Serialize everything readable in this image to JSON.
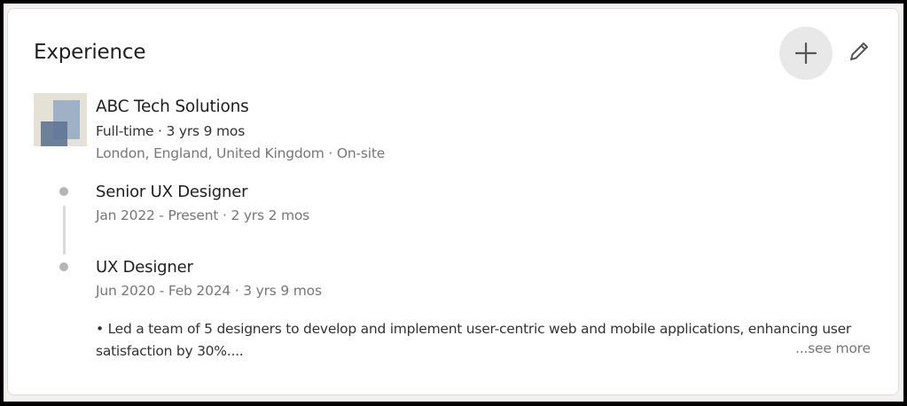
{
  "section": {
    "title": "Experience",
    "add_icon": "plus-icon",
    "edit_icon": "pencil-icon"
  },
  "company": {
    "name": "ABC Tech Solutions",
    "employment": "Full-time · 3 yrs 9 mos",
    "location": "London, England, United Kingdom · On-site",
    "logo_colors": {
      "bg": "#e6e1d6",
      "light": "#9eb1c6",
      "dark": "#5f7592"
    }
  },
  "roles": [
    {
      "title": "Senior UX Designer",
      "dates": "Jan 2022 - Present · 2 yrs 2 mos"
    },
    {
      "title": "UX Designer",
      "dates": "Jun 2020 - Feb 2024 · 3 yrs 9 mos"
    }
  ],
  "description": {
    "text": "• Led a team of 5 designers to develop and implement user-centric web and mobile applications, enhancing user satisfaction by 30%....",
    "see_more": "...see more"
  }
}
